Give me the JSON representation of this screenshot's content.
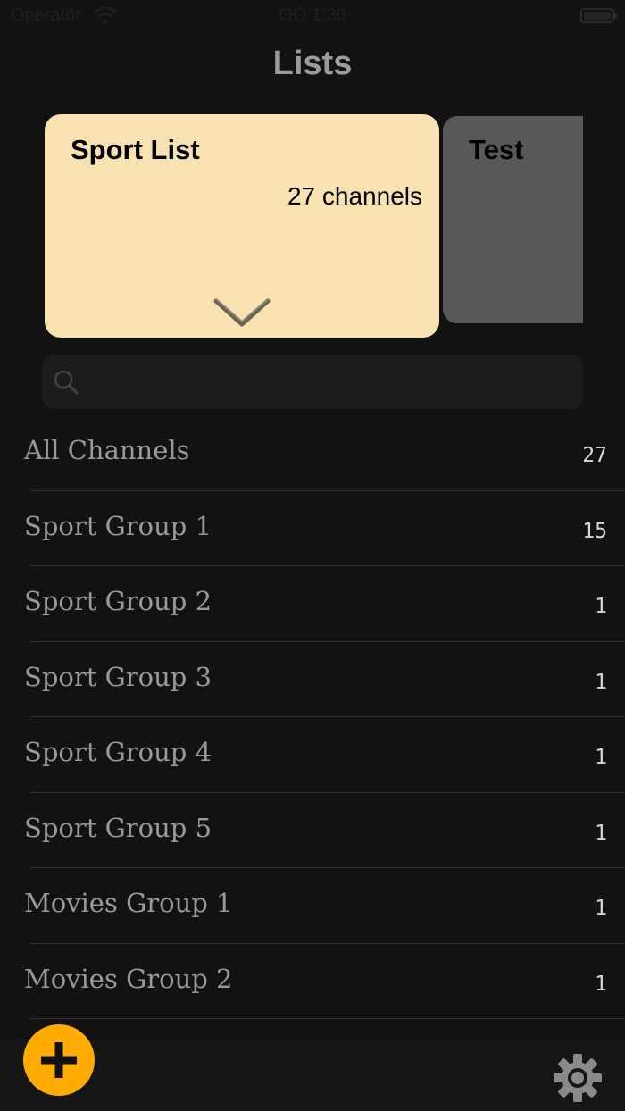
{
  "status_bar": {
    "carrier": "Operatör",
    "time": "ÖÖ 1:30"
  },
  "header": {
    "title": "Lists"
  },
  "cards": [
    {
      "title": "Sport List",
      "count_text": "27 channels"
    },
    {
      "title": "Test"
    }
  ],
  "search": {
    "placeholder": ""
  },
  "groups": [
    {
      "name": "All Channels",
      "count": "27"
    },
    {
      "name": "Sport Group 1",
      "count": "15"
    },
    {
      "name": "Sport Group 2",
      "count": "1"
    },
    {
      "name": "Sport Group 3",
      "count": "1"
    },
    {
      "name": "Sport Group 4",
      "count": "1"
    },
    {
      "name": "Sport Group 5",
      "count": "1"
    },
    {
      "name": "Movies Group 1",
      "count": "1"
    },
    {
      "name": "Movies Group 2",
      "count": "1"
    }
  ],
  "icons": {
    "add": "plus-icon",
    "settings": "gear-icon",
    "expand": "chevron-down-icon",
    "search": "search-icon"
  },
  "colors": {
    "background": "#121212",
    "active_card": "#f9e2b2",
    "inactive_card": "#585858",
    "accent": "#ffab00",
    "text_muted": "#9a9a9a"
  }
}
